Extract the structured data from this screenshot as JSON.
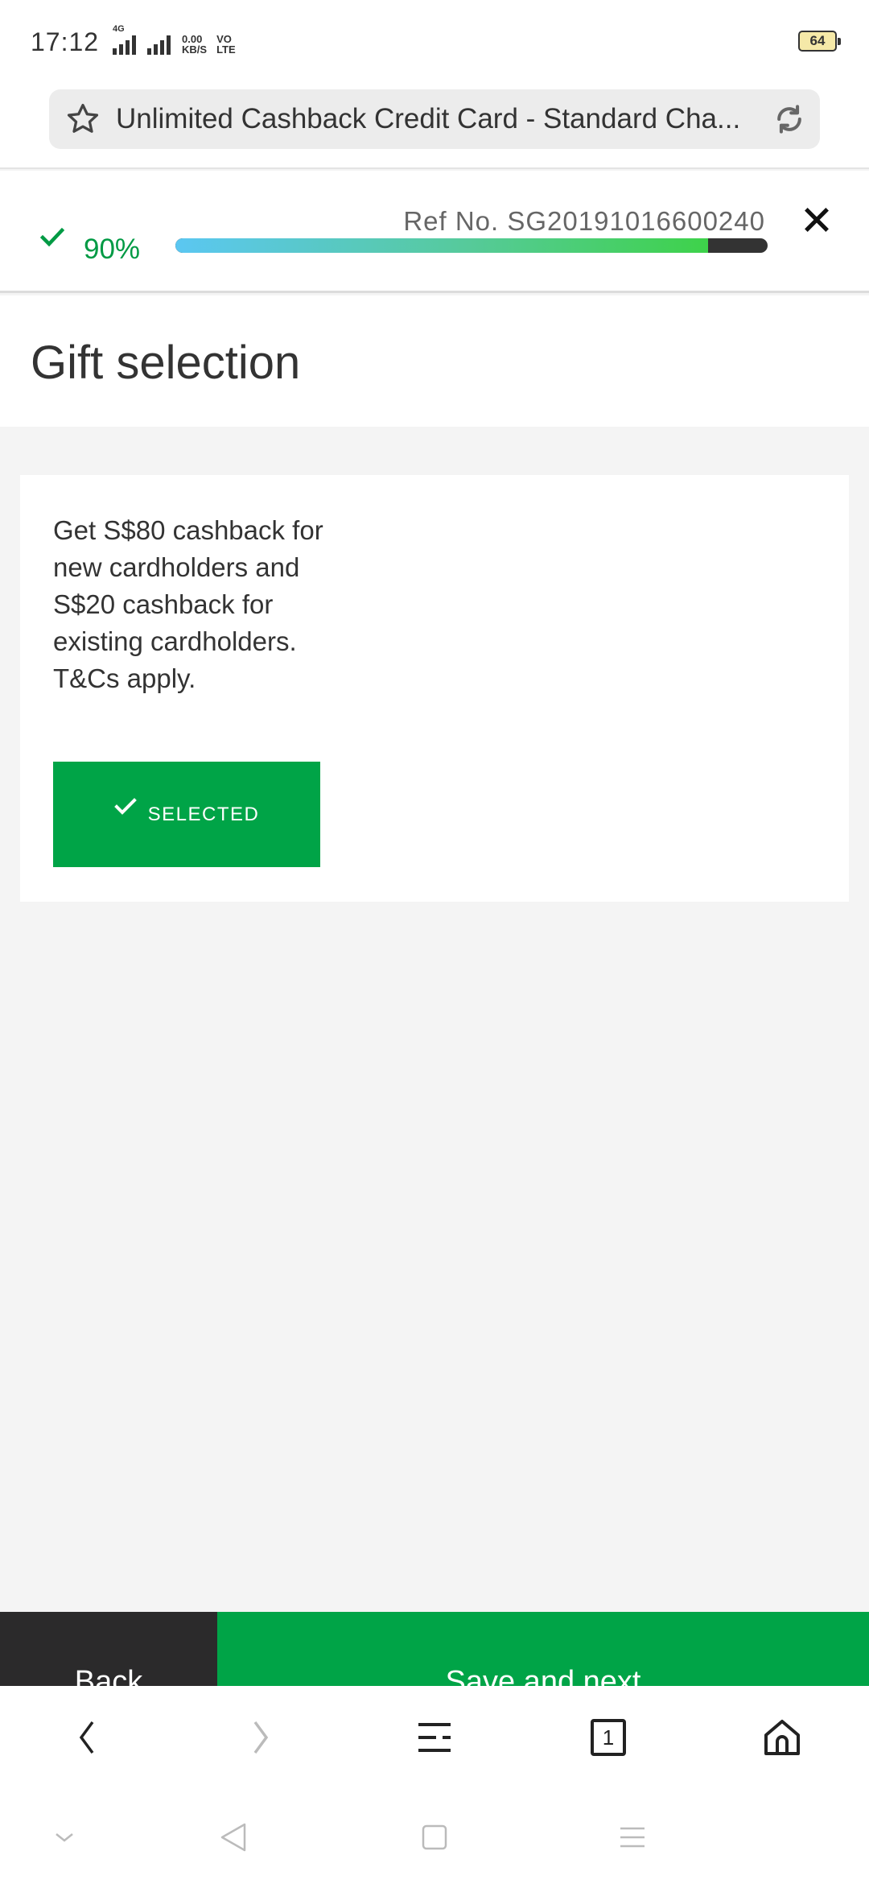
{
  "status_bar": {
    "time": "17:12",
    "network_type": "4G",
    "speed_value": "0.00",
    "speed_unit": "KB/S",
    "volte_top": "VO",
    "volte_bottom": "LTE",
    "battery": "64"
  },
  "url_bar": {
    "title": "Unlimited Cashback Credit Card - Standard Cha..."
  },
  "progress": {
    "percent_label": "90%",
    "percent_value": 0.9,
    "ref_label": "Ref No. SG20191016600240"
  },
  "page": {
    "title": "Gift selection"
  },
  "gift_card": {
    "description": "Get S$80 cashback for new cardholders and S$20 cashback for existing cardholders. T&Cs apply.",
    "button_label": "SELECTED"
  },
  "actions": {
    "back_label": "Back",
    "next_label": "Save and next"
  },
  "browser_nav": {
    "tab_count": "1"
  },
  "colors": {
    "brand_green": "#00a447",
    "progress_text_green": "#009a44",
    "progress_gradient_start": "#5bc7f2",
    "progress_gradient_end": "#3ed24a",
    "dark_button": "#2b2a2b"
  }
}
